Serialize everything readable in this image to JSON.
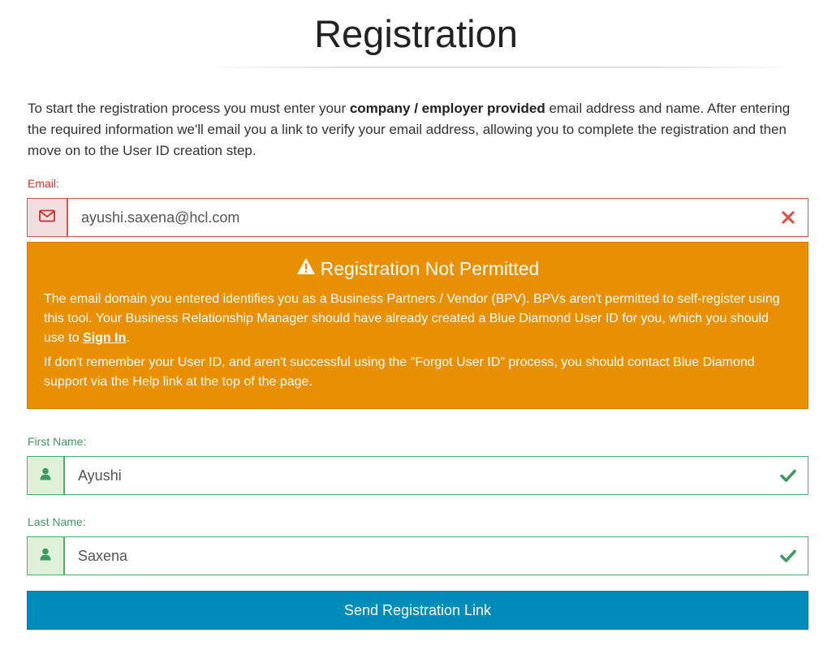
{
  "page": {
    "title": "Registration"
  },
  "intro": {
    "part1": "To start the registration process you must enter your ",
    "bold": "company / employer provided",
    "part2": " email address and name. After entering the required information we'll email you a link to verify your email address, allowing you to complete the registration and then move on to the User ID creation step."
  },
  "email": {
    "label": "Email:",
    "value": "ayushi.saxena@hcl.com",
    "state": "error",
    "addon_icon": "envelope-icon",
    "status_icon": "x-icon",
    "error_color": "#d9534f"
  },
  "alert": {
    "icon": "warning-icon",
    "title": "Registration Not Permitted",
    "p1_text": "The email domain you entered identifies you as a Business Partners / Vendor (BPV). BPVs aren't permitted to self-register using this tool. Your Business Relationship Manager should have already created a Blue Diamond User ID for you, which you should use to ",
    "p1_link": "Sign In",
    "p1_end": ".",
    "p2_text": "If don't remember your User ID, and aren't successful using the \"Forgot User ID\" process, you should contact Blue Diamond support via the Help link at the top of the page.",
    "background_color": "#e99002"
  },
  "first_name": {
    "label": "First Name:",
    "value": "Ayushi",
    "state": "valid",
    "addon_icon": "user-icon",
    "status_icon": "check-icon"
  },
  "last_name": {
    "label": "Last Name:",
    "value": "Saxena",
    "state": "valid",
    "addon_icon": "user-icon",
    "status_icon": "check-icon"
  },
  "submit": {
    "label": "Send Registration Link",
    "color": "#008cba"
  },
  "colors": {
    "success": "#3c9a5f",
    "error": "#c9302c"
  }
}
